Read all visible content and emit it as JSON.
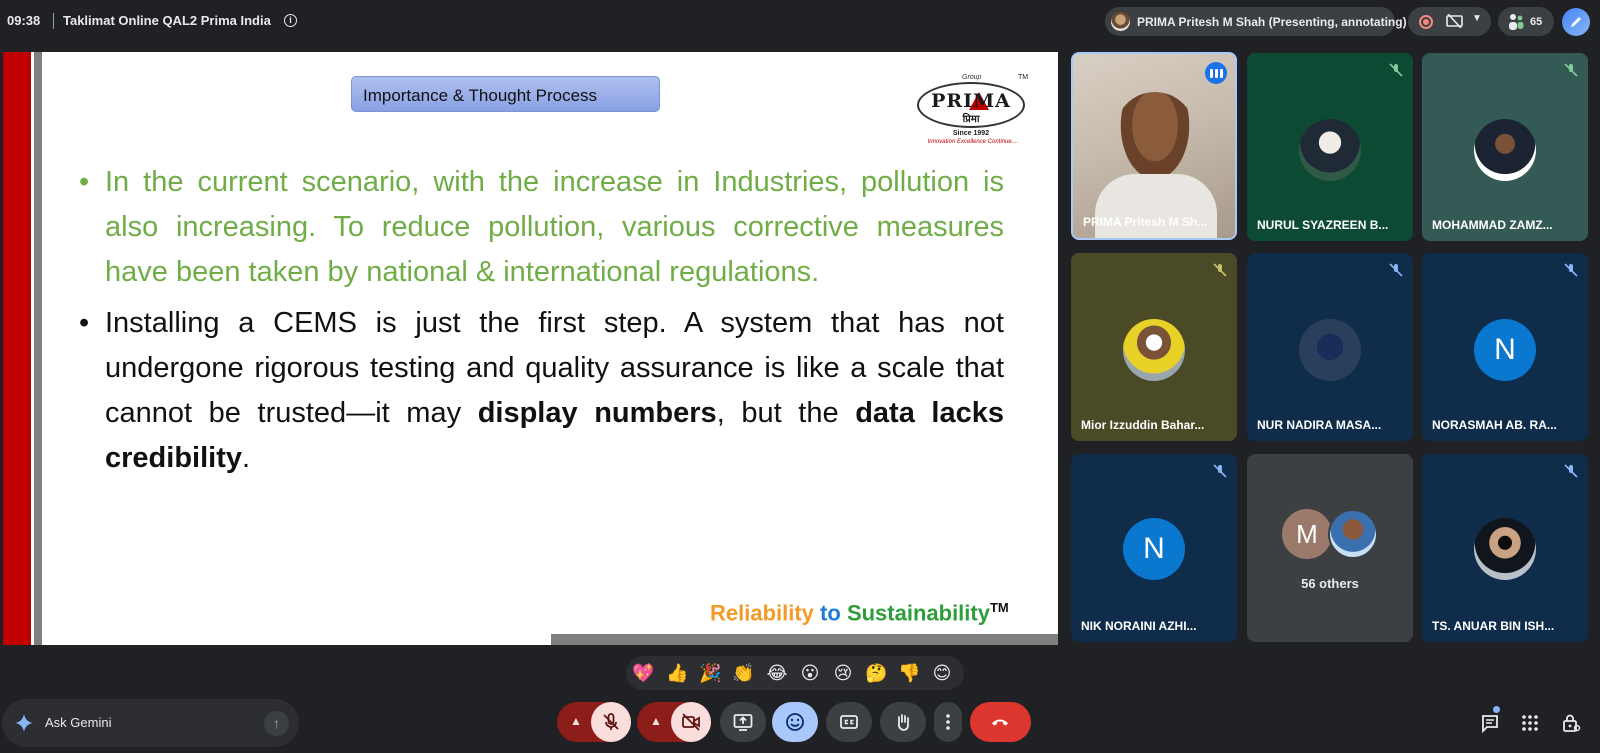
{
  "topbar": {
    "time": "09:38",
    "meeting_title": "Taklimat Online QAL2 Prima India",
    "presenter_status": "PRIMA Pritesh M Shah (Presenting, annotating)",
    "participant_count": "65"
  },
  "slide": {
    "heading": "Importance & Thought Process",
    "logo": {
      "group": "Group",
      "word": "PRIMA",
      "hindi": "प्रिमा",
      "since": "Since 1992",
      "tagline": "Innovation Excellence Continue....",
      "tm": "TM"
    },
    "bullet1": "In the current scenario, with the increase in Industries, pollution is also increasing. To reduce pollution, various corrective measures have been taken by national & international regulations.",
    "bullet2": {
      "part1": "Installing a CEMS is just the first step. A system that has not undergone rigorous testing and quality assurance is like a scale that cannot be trusted—it may ",
      "bold1": "display numbers",
      "part2": ", but the ",
      "bold2": "data lacks credibility",
      "part3": "."
    },
    "tagline": {
      "w1": "Reliability",
      "w2": "to",
      "w3": "Sustainability",
      "tm": "TM"
    }
  },
  "participants": {
    "t1": {
      "name": "PRIMA Pritesh M Sh..."
    },
    "t2": {
      "name": "NURUL SYAZREEN B..."
    },
    "t3": {
      "name": "MOHAMMAD ZAMZ..."
    },
    "t4": {
      "name": "Mior Izzuddin Bahar..."
    },
    "t5": {
      "name": "NUR NADIRA MASA..."
    },
    "t6": {
      "name": "NORASMAH AB. RA...",
      "initial": "N"
    },
    "t7": {
      "name": "NIK NORAINI AZHI...",
      "initial": "N"
    },
    "t8": {
      "initial": "M",
      "label": "56 others"
    },
    "t9": {
      "name": "TS. ANUAR BIN ISH..."
    }
  },
  "reactions": [
    "💖",
    "👍",
    "🎉",
    "👏",
    "😂",
    "😮",
    "😢",
    "🤔",
    "👎",
    "😊"
  ],
  "bottombar": {
    "ask_gemini": "Ask Gemini"
  },
  "colors": {
    "accent": "#1a73e8",
    "end_call": "#dc362e",
    "muted_control": "#f9dedc",
    "slide_green": "#70ad47",
    "slide_red_bar": "#c00000"
  }
}
